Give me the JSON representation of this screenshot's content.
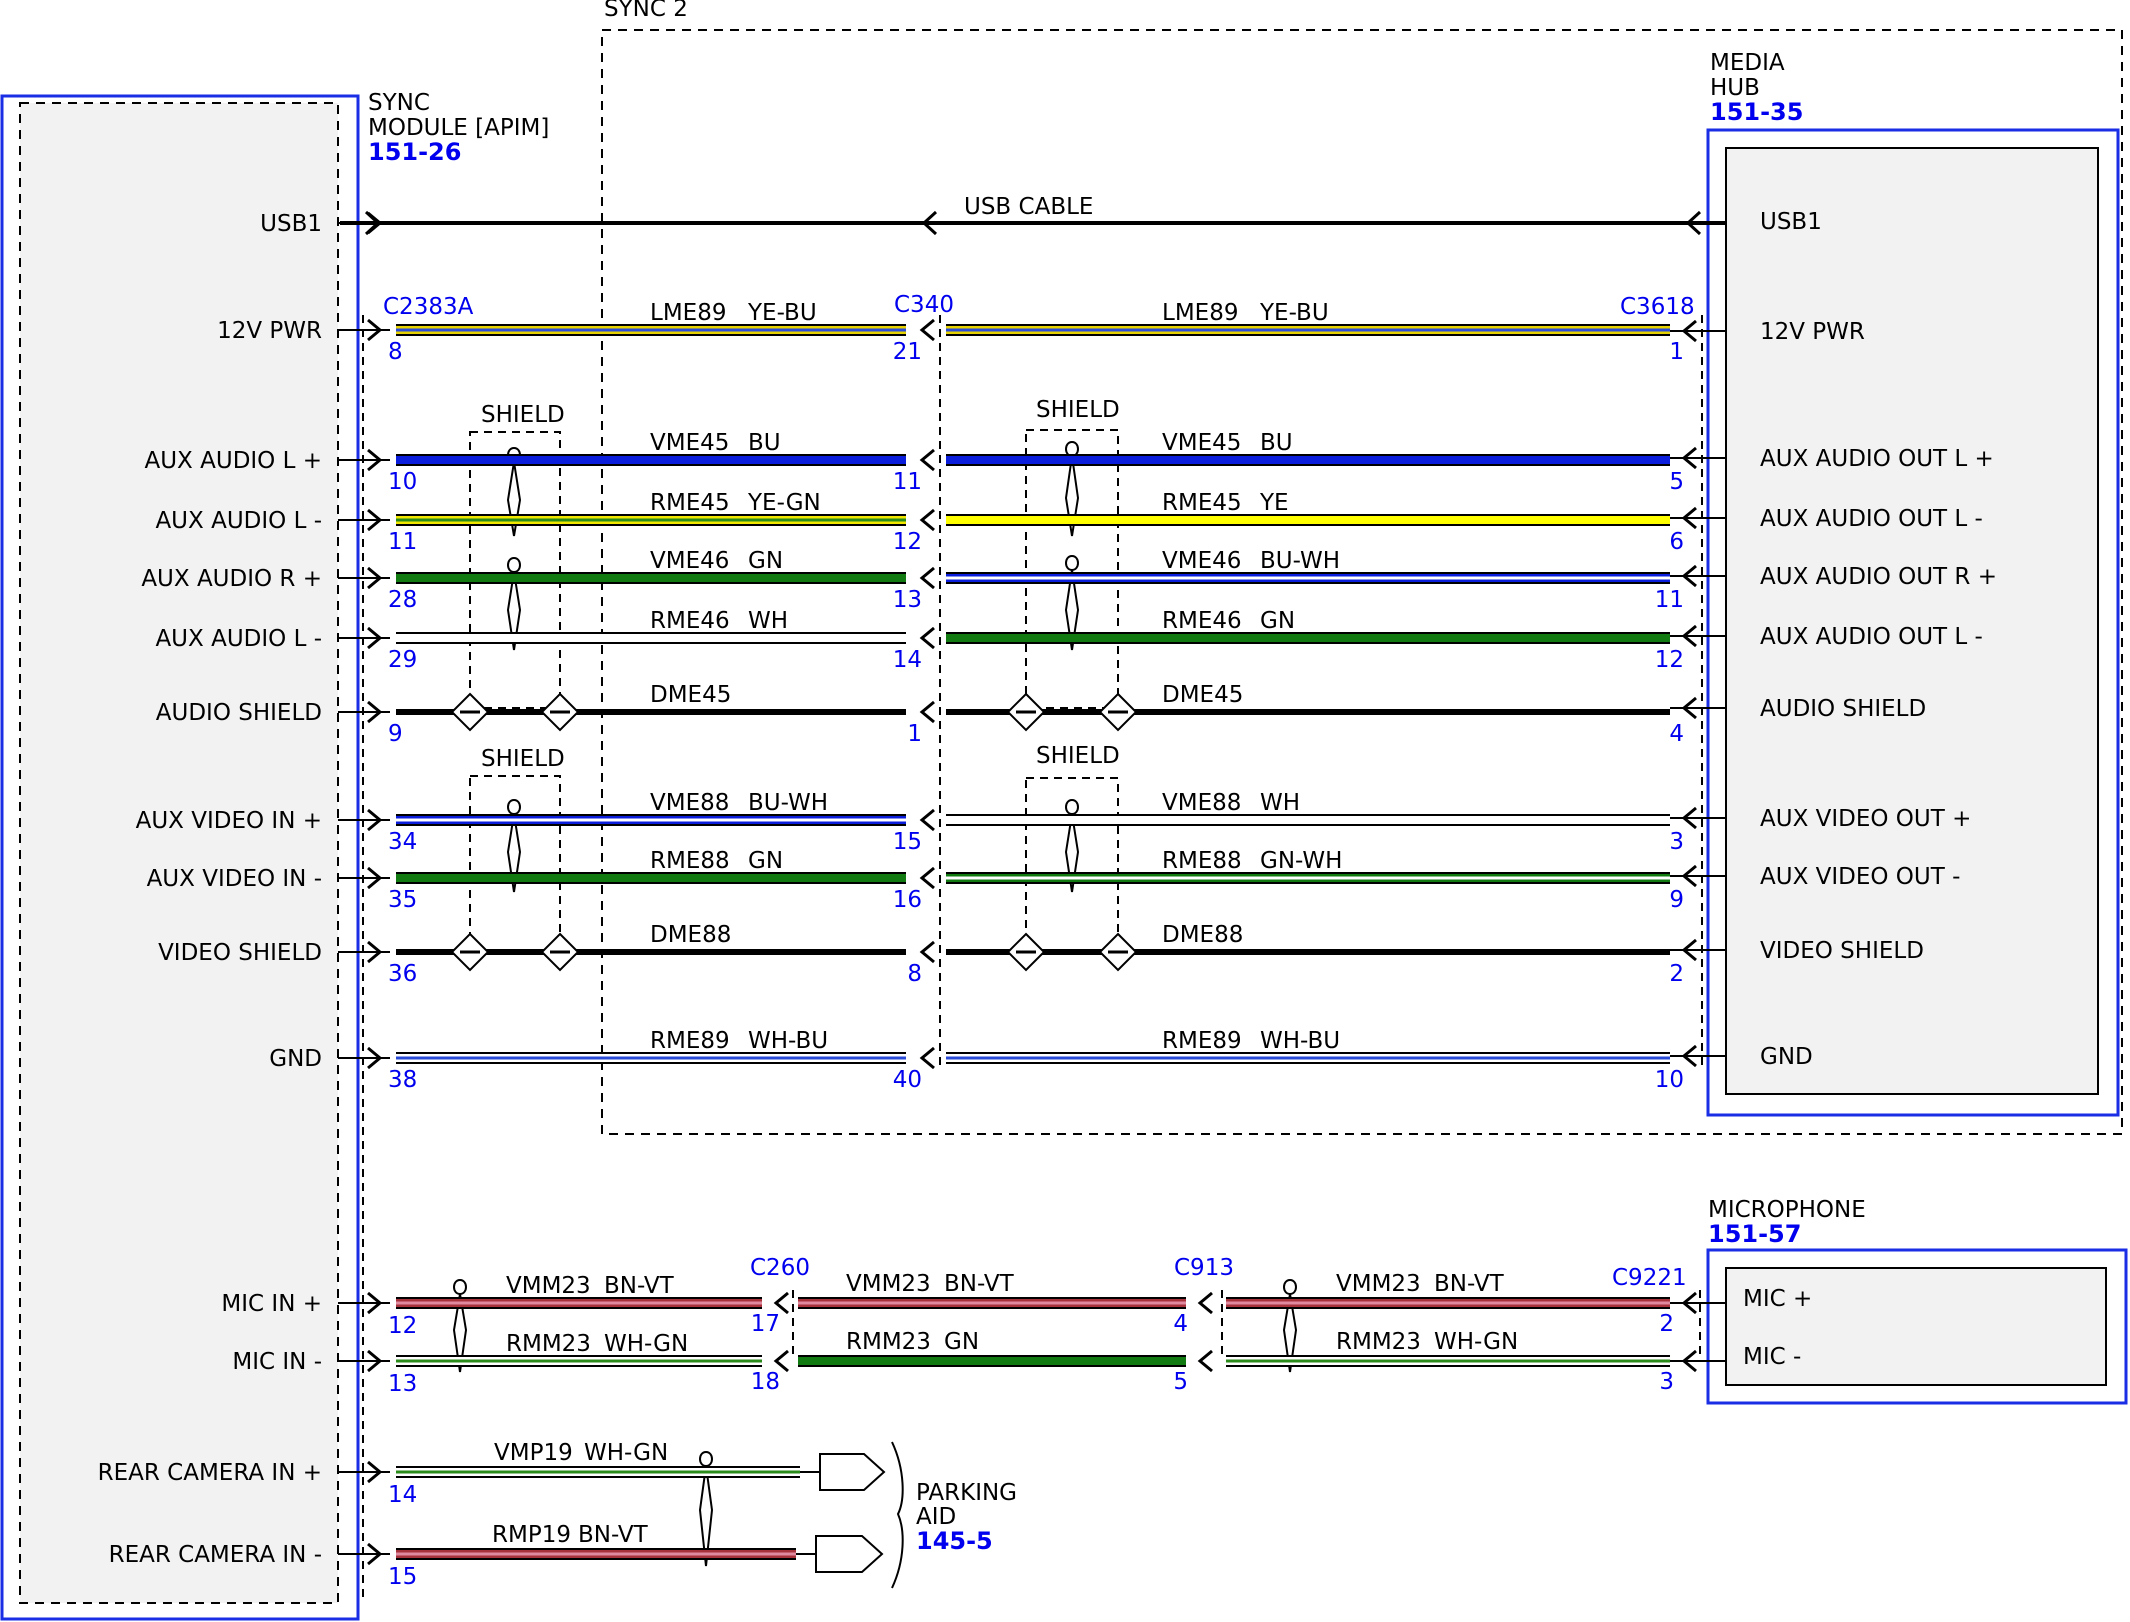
{
  "sync2_label": "SYNC 2",
  "usb_cable_label": "USB CABLE",
  "sync_module": {
    "name_lines": [
      "SYNC",
      "MODULE [APIM]"
    ],
    "ref": "151-26",
    "pins": [
      {
        "label": "USB1"
      },
      {
        "label": "12V PWR"
      },
      {
        "label": "AUX AUDIO L +"
      },
      {
        "label": "AUX AUDIO L -"
      },
      {
        "label": "AUX AUDIO R +"
      },
      {
        "label": "AUX AUDIO L -"
      },
      {
        "label": "AUDIO SHIELD"
      },
      {
        "label": "AUX VIDEO IN +"
      },
      {
        "label": "AUX VIDEO IN -"
      },
      {
        "label": "VIDEO SHIELD"
      },
      {
        "label": "GND"
      },
      {
        "label": "MIC IN +"
      },
      {
        "label": "MIC IN -"
      },
      {
        "label": "REAR CAMERA IN +"
      },
      {
        "label": "REAR CAMERA IN -"
      }
    ]
  },
  "media_hub": {
    "name_lines": [
      "MEDIA",
      "HUB"
    ],
    "ref": "151-35",
    "pins": [
      "USB1",
      "12V PWR",
      "AUX AUDIO OUT L +",
      "AUX AUDIO OUT L -",
      "AUX AUDIO OUT R +",
      "AUX AUDIO OUT L -",
      "AUDIO SHIELD",
      "AUX VIDEO OUT +",
      "AUX VIDEO OUT -",
      "VIDEO SHIELD",
      "GND"
    ]
  },
  "microphone": {
    "name": "MICROPHONE",
    "ref": "151-57",
    "pins": [
      "MIC +",
      "MIC -"
    ]
  },
  "parking_aid": {
    "name_lines": [
      "PARKING",
      "AID"
    ],
    "ref": "145-5"
  },
  "connectors": {
    "c2383a": "C2383A",
    "c340": "C340",
    "c3618": "C3618",
    "c260": "C260",
    "c913": "C913",
    "c9221": "C9221"
  },
  "shield_label": "SHIELD",
  "sync_hub_wires": [
    {
      "left": {
        "circuit": "LME89",
        "color": "YE-BU",
        "pin_a": "8",
        "pin_b": "21"
      },
      "right": {
        "circuit": "LME89",
        "color": "YE-BU",
        "pin_b": "1"
      },
      "left_colors": [
        "#e6d200",
        "#2a4bd7"
      ],
      "right_colors": [
        "#e6d200",
        "#2a4bd7"
      ]
    },
    {
      "left": {
        "circuit": "VME45",
        "color": "BU",
        "pin_a": "10",
        "pin_b": "11"
      },
      "right": {
        "circuit": "VME45",
        "color": "BU",
        "pin_b": "5"
      },
      "left_colors": [
        "#0a1edc"
      ],
      "right_colors": [
        "#0a1edc"
      ]
    },
    {
      "left": {
        "circuit": "RME45",
        "color": "YE-GN",
        "pin_a": "11",
        "pin_b": "12"
      },
      "right": {
        "circuit": "RME45",
        "color": "YE",
        "pin_b": "6"
      },
      "left_colors": [
        "#f0e600",
        "#2a8a1a"
      ],
      "right_colors": [
        "#ffff00"
      ]
    },
    {
      "left": {
        "circuit": "VME46",
        "color": "GN",
        "pin_a": "28",
        "pin_b": "13"
      },
      "right": {
        "circuit": "VME46",
        "color": "BU-WH",
        "pin_b": "11"
      },
      "left_colors": [
        "#117a11"
      ],
      "right_colors": [
        "#0a1edc",
        "#ffffff"
      ]
    },
    {
      "left": {
        "circuit": "RME46",
        "color": "WH",
        "pin_a": "29",
        "pin_b": "14"
      },
      "right": {
        "circuit": "RME46",
        "color": "GN",
        "pin_b": "12"
      },
      "left_colors": [
        "#ffffff"
      ],
      "right_colors": [
        "#117a11"
      ]
    },
    {
      "left": {
        "circuit": "DME45",
        "color": "",
        "pin_a": "9",
        "pin_b": "1"
      },
      "right": {
        "circuit": "DME45",
        "color": "",
        "pin_b": "4"
      },
      "left_colors": [
        "#000000"
      ],
      "right_colors": [
        "#000000"
      ]
    },
    {
      "left": {
        "circuit": "VME88",
        "color": "BU-WH",
        "pin_a": "34",
        "pin_b": "15"
      },
      "right": {
        "circuit": "VME88",
        "color": "WH",
        "pin_b": "3"
      },
      "left_colors": [
        "#0a1edc",
        "#ffffff"
      ],
      "right_colors": [
        "#ffffff"
      ]
    },
    {
      "left": {
        "circuit": "RME88",
        "color": "GN",
        "pin_a": "35",
        "pin_b": "16"
      },
      "right": {
        "circuit": "RME88",
        "color": "GN-WH",
        "pin_b": "9"
      },
      "left_colors": [
        "#117a11"
      ],
      "right_colors": [
        "#117a11",
        "#ffffff"
      ]
    },
    {
      "left": {
        "circuit": "DME88",
        "color": "",
        "pin_a": "36",
        "pin_b": "8"
      },
      "right": {
        "circuit": "DME88",
        "color": "",
        "pin_b": "2"
      },
      "left_colors": [
        "#000000"
      ],
      "right_colors": [
        "#000000"
      ]
    },
    {
      "left": {
        "circuit": "RME89",
        "color": "WH-BU",
        "pin_a": "38",
        "pin_b": "40"
      },
      "right": {
        "circuit": "RME89",
        "color": "WH-BU",
        "pin_b": "10"
      },
      "left_colors": [
        "#ffffff",
        "#2a4bd7"
      ],
      "right_colors": [
        "#ffffff",
        "#2a4bd7"
      ]
    }
  ],
  "mic_wires": [
    {
      "seg1": {
        "circuit": "VMM23",
        "color": "BN-VT",
        "pin_a": "12",
        "pin_b": "17"
      },
      "seg2": {
        "circuit": "VMM23",
        "color": "BN-VT",
        "pin_b": "4"
      },
      "seg3": {
        "circuit": "VMM23",
        "color": "BN-VT",
        "pin_b": "2"
      },
      "seg1_colors": [
        "#a8323c",
        "#e08aa0"
      ],
      "seg2_colors": [
        "#a8323c",
        "#e08aa0"
      ],
      "seg3_colors": [
        "#a8323c",
        "#e08aa0"
      ]
    },
    {
      "seg1": {
        "circuit": "RMM23",
        "color": "WH-GN",
        "pin_a": "13",
        "pin_b": "18"
      },
      "seg2": {
        "circuit": "RMM23",
        "color": "GN",
        "pin_b": "5"
      },
      "seg3": {
        "circuit": "RMM23",
        "color": "WH-GN",
        "pin_b": "3"
      },
      "seg1_colors": [
        "#ffffff",
        "#2a8a1a"
      ],
      "seg2_colors": [
        "#117a11"
      ],
      "seg3_colors": [
        "#ffffff",
        "#2a8a1a"
      ]
    }
  ],
  "camera_wires": [
    {
      "circuit": "VMP19",
      "color": "WH-GN",
      "pin": "14",
      "colors": [
        "#ffffff",
        "#2a8a1a"
      ]
    },
    {
      "circuit": "RMP19",
      "color": "BN-VT",
      "pin": "15",
      "colors": [
        "#a8323c",
        "#e08aa0"
      ]
    }
  ]
}
